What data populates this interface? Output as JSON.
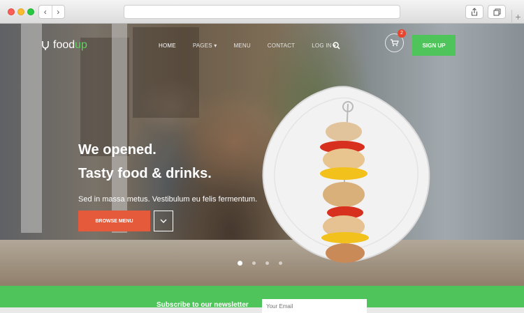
{
  "site": {
    "logo_text": "food",
    "logo_accent": "up",
    "nav": [
      {
        "label": "HOME",
        "active": true
      },
      {
        "label": "PAGES ▾",
        "active": false
      },
      {
        "label": "MENU",
        "active": false
      },
      {
        "label": "CONTACT",
        "active": false
      },
      {
        "label": "LOG IN ▾",
        "active": false
      }
    ],
    "cart_count": "2",
    "signup_label": "SIGN UP"
  },
  "hero": {
    "headline_1": "We opened.",
    "headline_2": "Tasty food & drinks.",
    "subtitle": "Sed in massa metus. Vestibulum eu felis fermentum.",
    "browse_label": "BROWSE MENU",
    "slides": 4,
    "active_slide": 1
  },
  "newsletter": {
    "label": "Subscribe to our newsletter",
    "email_placeholder": "Your Email"
  },
  "colors": {
    "brand_green": "#4fc45a",
    "cta_orange": "#e55a3a",
    "badge_red": "#e8452e"
  },
  "icons": [
    "back-icon",
    "forward-icon",
    "share-icon",
    "tabs-icon",
    "search-icon",
    "cart-icon",
    "chevron-down-icon",
    "leaf-logo-icon"
  ]
}
